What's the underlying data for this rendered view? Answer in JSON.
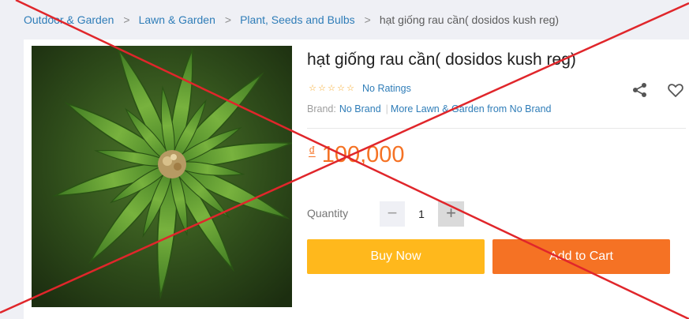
{
  "breadcrumb": {
    "items": [
      "Outdoor & Garden",
      "Lawn & Garden",
      "Plant, Seeds and Bulbs"
    ],
    "separator": ">",
    "current": "hạt giống rau cần( dosidos kush reg)"
  },
  "product": {
    "title": "hạt giống rau cần( dosidos kush reg)",
    "ratings_text": "No Ratings",
    "stars_filled": 0,
    "stars_total": 5,
    "brand_label": "Brand:",
    "brand_name": "No Brand",
    "brand_separator": "|",
    "more_from": "More Lawn & Garden from No Brand",
    "currency": "₫",
    "price": "100,000"
  },
  "quantity": {
    "label": "Quantity",
    "minus": "−",
    "value": "1",
    "plus": "+"
  },
  "actions": {
    "buy_now": "Buy Now",
    "add_to_cart": "Add to Cart"
  },
  "icons": {
    "share": "share-icon",
    "wishlist": "heart-icon"
  },
  "colors": {
    "link": "#2f7db8",
    "price": "#f57224",
    "buy_now": "#ffb81c",
    "add_to_cart": "#f57224",
    "overlay_cross": "#e0262b"
  }
}
